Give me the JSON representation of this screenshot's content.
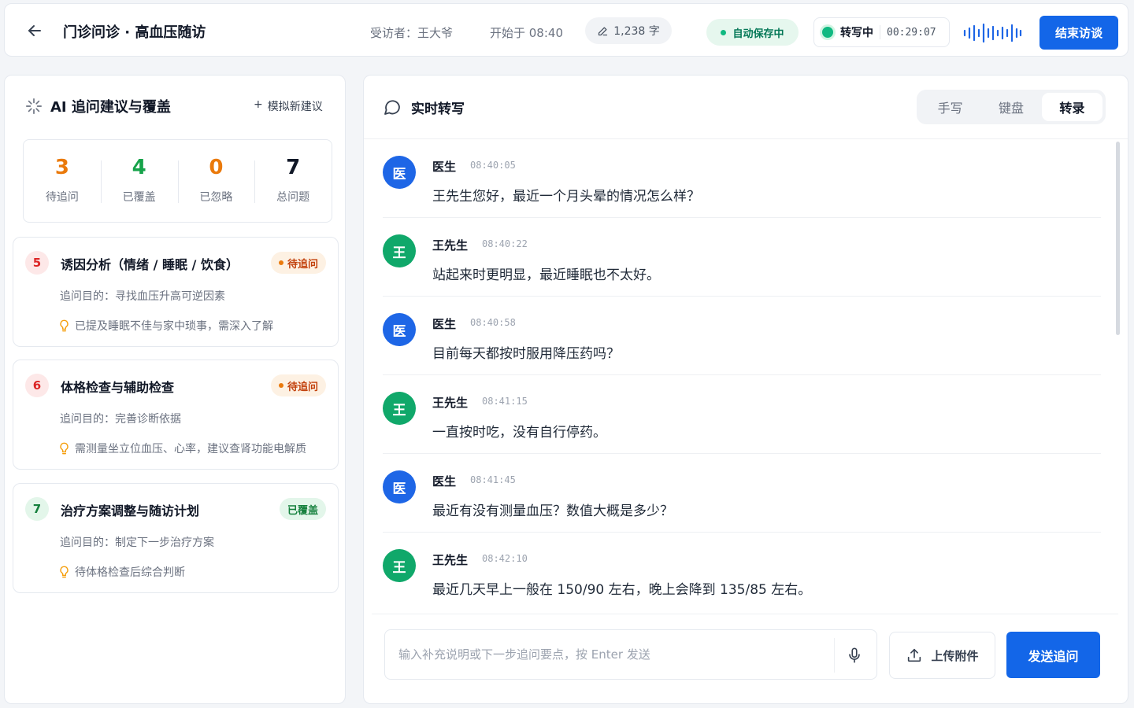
{
  "header": {
    "title": "门诊问诊 · 高血压随访",
    "interviewee": "受访者：王大爷",
    "start_time": "开始于 08:40",
    "word_count": "1,238 字",
    "autosave": "自动保存中",
    "recording_label": "转写中",
    "recording_timer": "00:29:07",
    "end_button": "结束访谈"
  },
  "left_panel": {
    "title": "AI 追问建议与覆盖",
    "simulate_button": "模拟新建议",
    "stats": [
      {
        "value": "3",
        "label": "待追问",
        "color": "#ea7a0c"
      },
      {
        "value": "4",
        "label": "已覆盖",
        "color": "#16a34a"
      },
      {
        "value": "0",
        "label": "已忽略",
        "color": "#ea7a0c"
      },
      {
        "value": "7",
        "label": "总问题",
        "color": "#111827"
      }
    ],
    "cards": [
      {
        "number": "5",
        "title": "诱因分析（情绪 / 睡眠 / 饮食）",
        "status": "待追问",
        "purpose": "追问目的：寻找血压升高可逆因素",
        "hint": "已提及睡眠不佳与家中琐事，需深入了解"
      },
      {
        "number": "6",
        "title": "体格检查与辅助检查",
        "status": "待追问",
        "purpose": "追问目的：完善诊断依据",
        "hint": "需测量坐立位血压、心率，建议查肾功能电解质"
      },
      {
        "number": "7",
        "title": "治疗方案调整与随访计划",
        "status": "已覆盖",
        "purpose": "追问目的：制定下一步治疗方案",
        "hint": "待体格检查后综合判断"
      }
    ]
  },
  "transcript": {
    "title": "实时转写",
    "tabs": [
      "手写",
      "键盘",
      "转录"
    ],
    "active_tab": "转录",
    "messages": [
      {
        "avatar": "医",
        "speaker": "医生",
        "time": "08:40:05",
        "text": "王先生您好，最近一个月头晕的情况怎么样？"
      },
      {
        "avatar": "王",
        "speaker": "王先生",
        "time": "08:40:22",
        "text": "站起来时更明显，最近睡眠也不太好。"
      },
      {
        "avatar": "医",
        "speaker": "医生",
        "time": "08:40:58",
        "text": "目前每天都按时服用降压药吗？"
      },
      {
        "avatar": "王",
        "speaker": "王先生",
        "time": "08:41:15",
        "text": "一直按时吃，没有自行停药。"
      },
      {
        "avatar": "医",
        "speaker": "医生",
        "time": "08:41:45",
        "text": "最近有没有测量血压？数值大概是多少？"
      },
      {
        "avatar": "王",
        "speaker": "王先生",
        "time": "08:42:10",
        "text": "最近几天早上一般在 150/90 左右，晚上会降到 135/85 左右。"
      }
    ]
  },
  "composer": {
    "placeholder": "输入补充说明或下一步追问要点，按 Enter 发送",
    "value": "",
    "upload_button": "上传附件",
    "send_button": "发送追问"
  },
  "colors": {
    "primary": "#1366e8",
    "doctor_avatar": "#1e66e6",
    "patient_avatar": "#10a86a",
    "pending": "#ea7a0c",
    "covered": "#16a34a"
  },
  "icons": [
    "back-arrow-icon",
    "pencil-icon",
    "sparkle-icon",
    "plus-icon",
    "lightbulb-icon",
    "chat-bubble-icon",
    "microphone-icon",
    "upload-icon",
    "waveform-icon"
  ]
}
